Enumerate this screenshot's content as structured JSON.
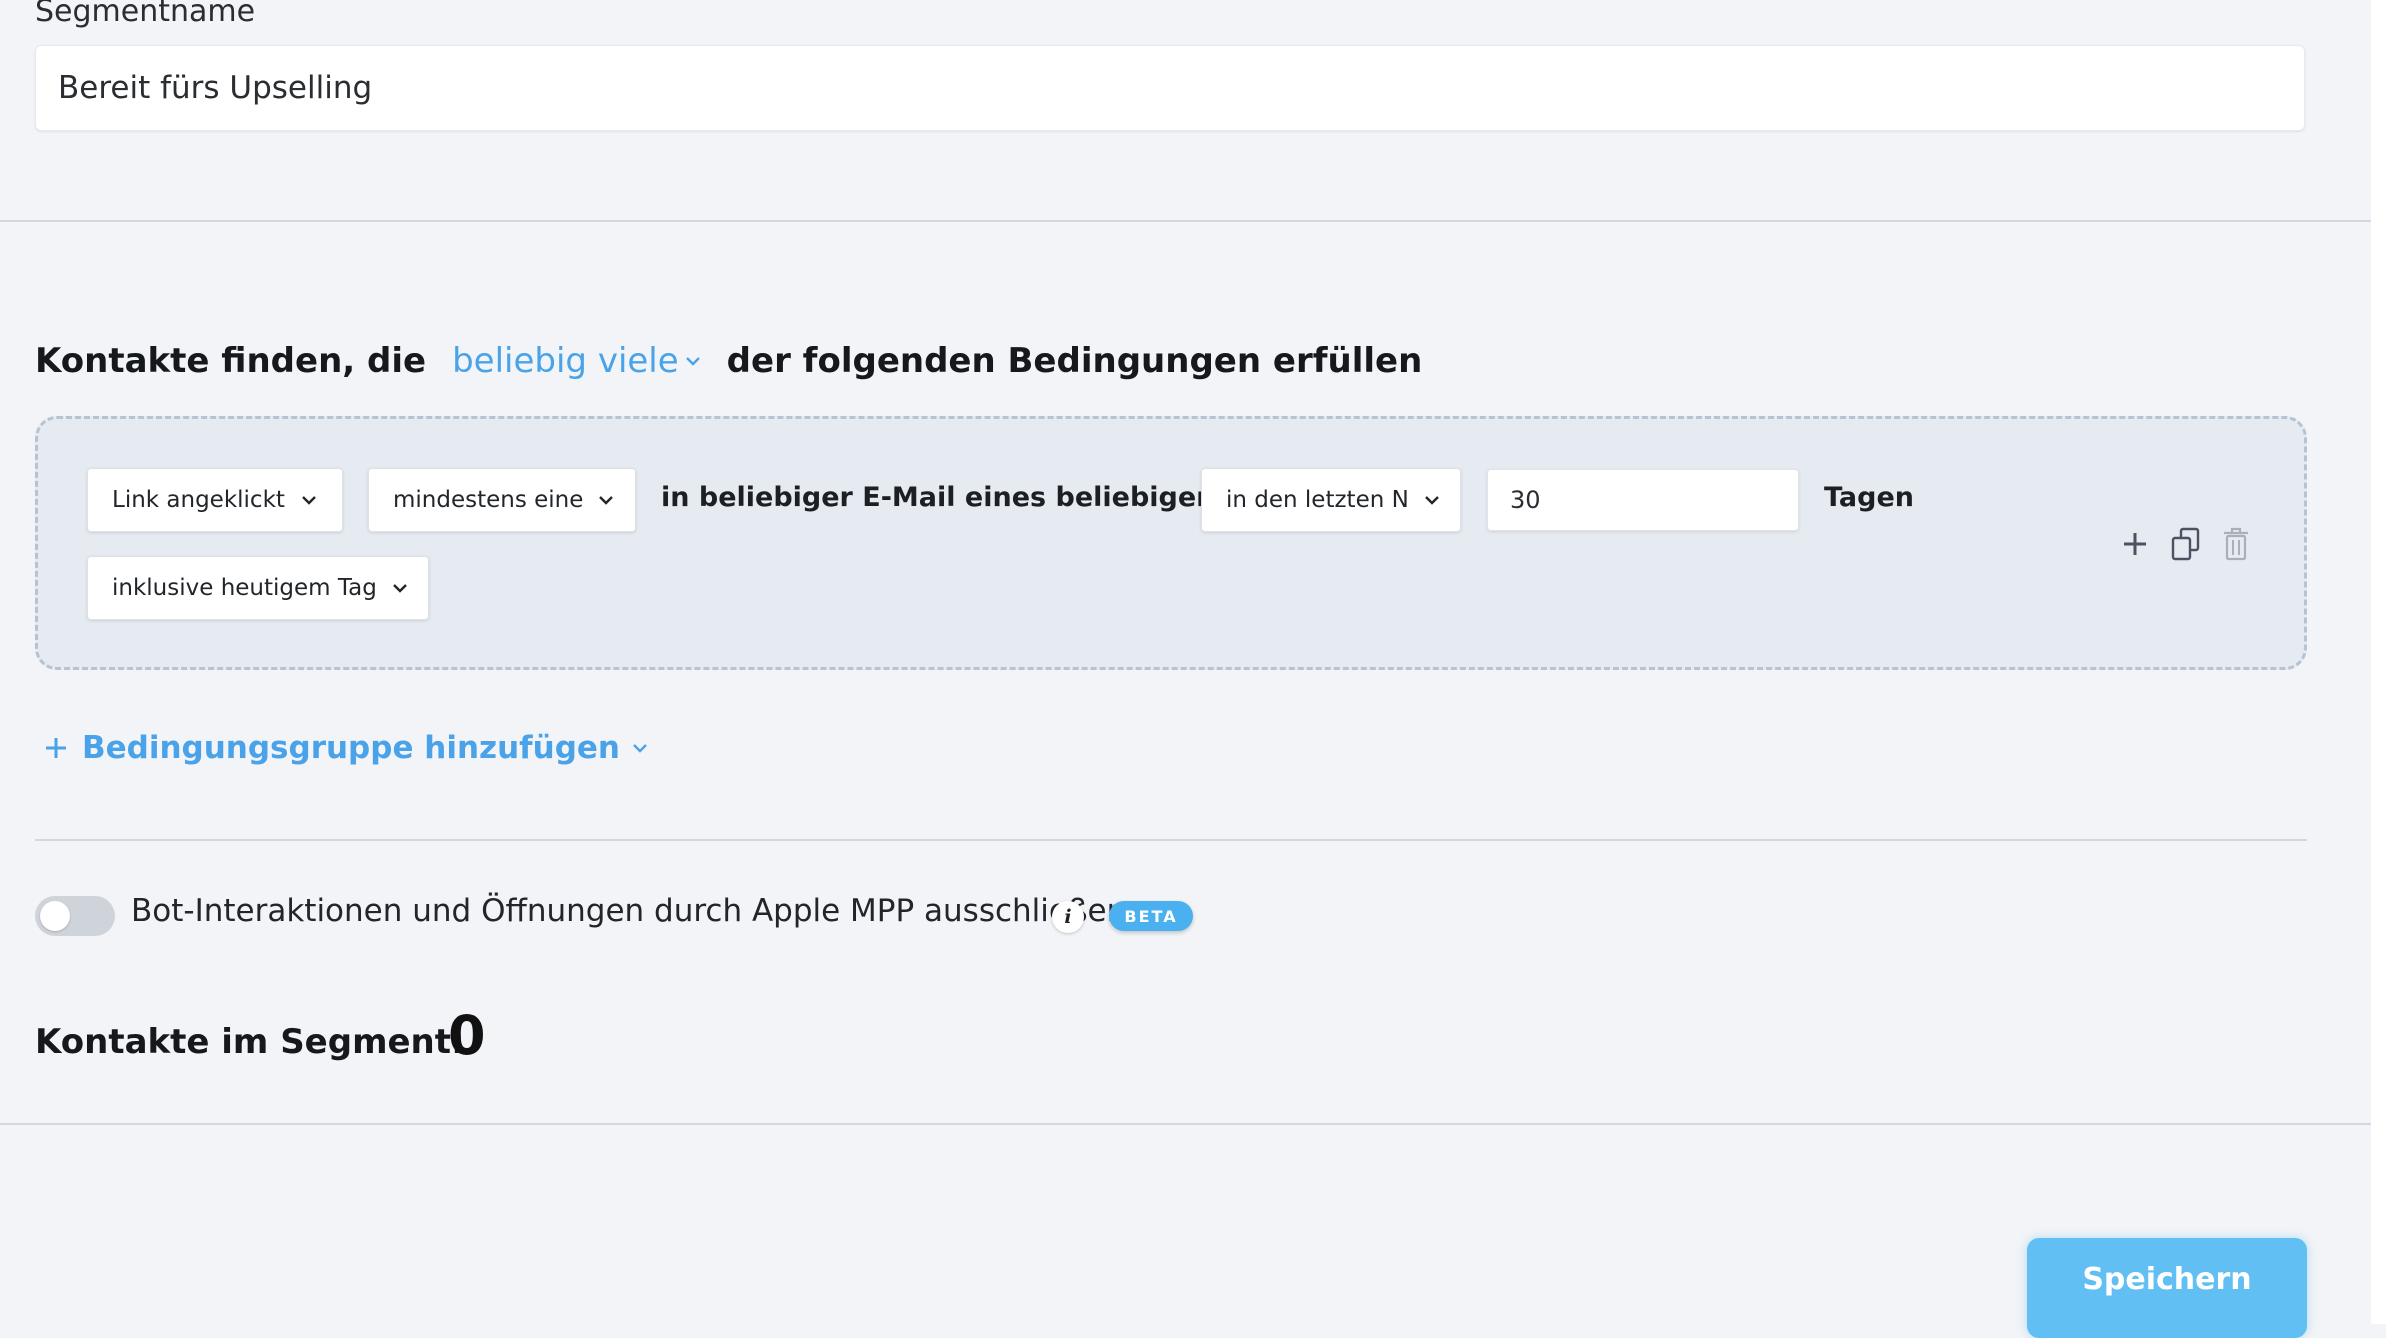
{
  "segment": {
    "label": "Segmentname",
    "value": "Bereit fürs Upselling"
  },
  "conditions": {
    "heading_prefix": "Kontakte finden, die",
    "match_mode": "beliebig viele",
    "heading_suffix": "der folgenden Bedingungen erfüllen",
    "group": {
      "event_dropdown": "Link angeklickt",
      "quantity_dropdown": "mindestens eine",
      "scope_text": "in beliebiger E-Mail eines beliebigen Typs",
      "timeframe_dropdown": "in den letzten N",
      "days_value": "30",
      "days_unit": "Tagen",
      "include_today_dropdown": "inklusive heutigem Tag"
    },
    "add_group_label": "Bedingungsgruppe hinzufügen"
  },
  "bot_filter": {
    "label": "Bot-Interaktionen und Öffnungen durch Apple MPP ausschließen",
    "enabled": false,
    "info_icon": "i",
    "badge": "BETA"
  },
  "contacts": {
    "label": "Kontakte im Segment:",
    "count": "0"
  },
  "actions": {
    "save_label": "Speichern"
  },
  "colors": {
    "accent": "#4aa3e8",
    "save_button": "#62bff3",
    "badge": "#4ab0ef"
  }
}
